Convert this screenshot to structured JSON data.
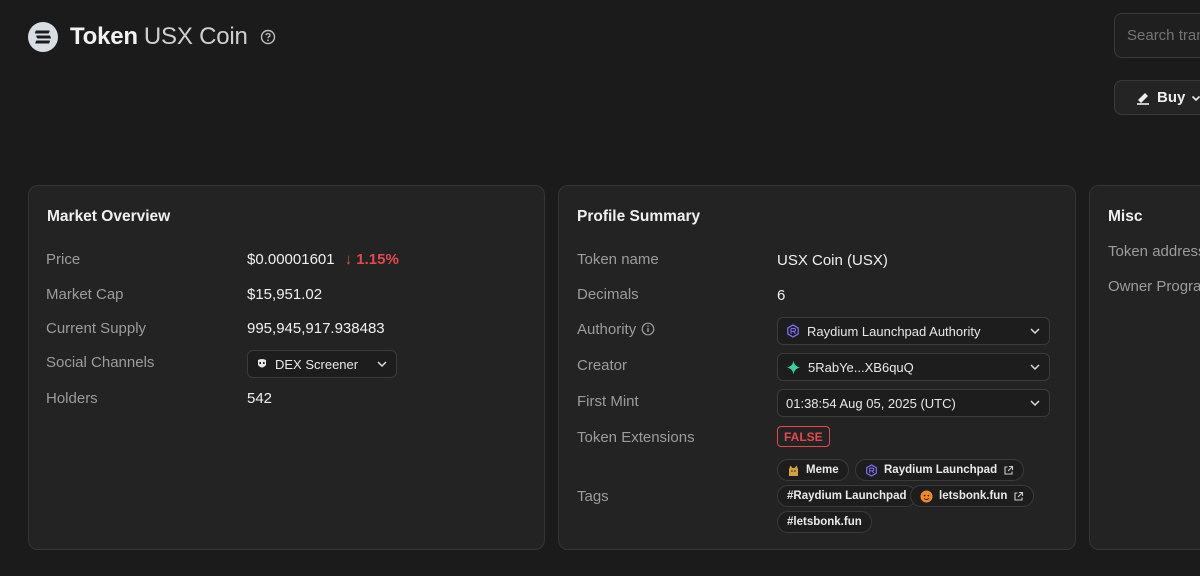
{
  "header": {
    "title_prefix": "Token",
    "title_name": "USX Coin"
  },
  "search": {
    "placeholder": "Search transactions"
  },
  "buy": {
    "label": "Buy"
  },
  "market": {
    "title": "Market Overview",
    "price_label": "Price",
    "price_value": "$0.00001601",
    "price_change": "↓ 1.15%",
    "cap_label": "Market Cap",
    "cap_value": "$15,951.02",
    "supply_label": "Current Supply",
    "supply_value": "995,945,917.938483",
    "social_label": "Social Channels",
    "social_value": "DEX Screener",
    "holders_label": "Holders",
    "holders_value": "542"
  },
  "profile": {
    "title": "Profile Summary",
    "name_label": "Token name",
    "name_value": "USX Coin (USX)",
    "decimals_label": "Decimals",
    "decimals_value": "6",
    "authority_label": "Authority",
    "authority_value": "Raydium Launchpad Authority",
    "creator_label": "Creator",
    "creator_value": "5RabYe...XB6quQ",
    "mint_label": "First Mint",
    "mint_value": "01:38:54 Aug 05, 2025 (UTC)",
    "ext_label": "Token Extensions",
    "ext_value": "FALSE",
    "tags_label": "Tags",
    "tags": [
      "Meme",
      "Raydium Launchpad",
      "#Raydium Launchpad",
      "letsbonk.fun",
      "#letsbonk.fun"
    ]
  },
  "misc": {
    "title": "Misc",
    "address_label": "Token address",
    "owner_label": "Owner Program"
  },
  "colors": {
    "accent_negative": "#e5484d",
    "background": "#1b1b1b",
    "card": "#232323"
  }
}
